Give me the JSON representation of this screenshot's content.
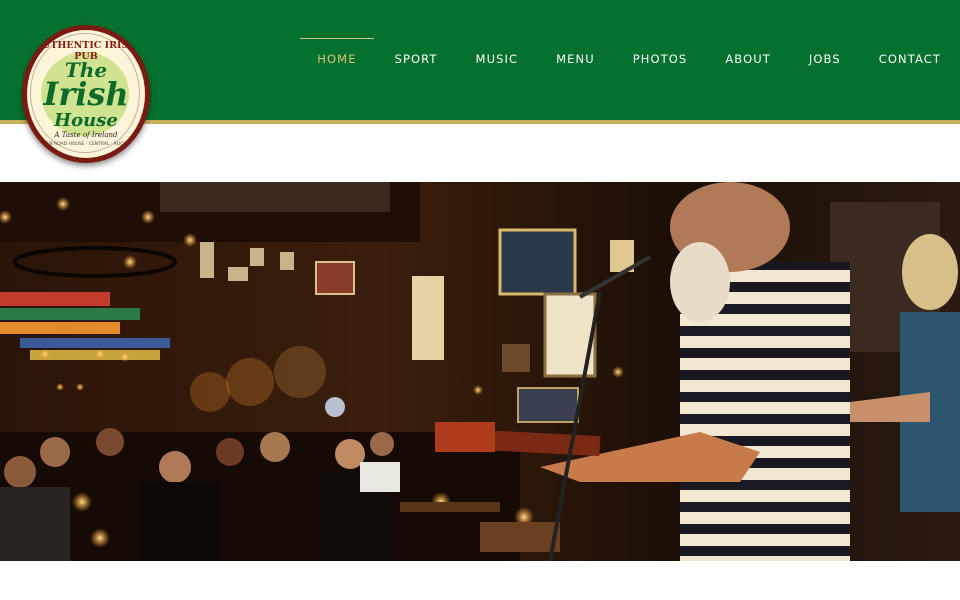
{
  "nav": {
    "items": [
      {
        "label": "HOME",
        "active": true
      },
      {
        "label": "SPORT",
        "active": false
      },
      {
        "label": "MUSIC",
        "active": false
      },
      {
        "label": "MENU",
        "active": false
      },
      {
        "label": "PHOTOS",
        "active": false
      },
      {
        "label": "ABOUT",
        "active": false
      },
      {
        "label": "JOBS",
        "active": false
      },
      {
        "label": "CONTACT",
        "active": false
      }
    ]
  },
  "logo": {
    "arc_top": "AUTHENTIC IRISH PUB",
    "line1": "The",
    "line2": "Irish",
    "line3": "House",
    "tagline": "A Taste of Ireland",
    "arc_bottom": "GARDEN ROAD HOUSE · CENTRAL · AUCKLAND"
  },
  "hero": {
    "image_subject": "live-music-photo"
  },
  "colors": {
    "header_green": "#04712e",
    "accent_gold": "#c8b15a",
    "nav_text": "#ffffff",
    "nav_active": "#d6c57a"
  }
}
